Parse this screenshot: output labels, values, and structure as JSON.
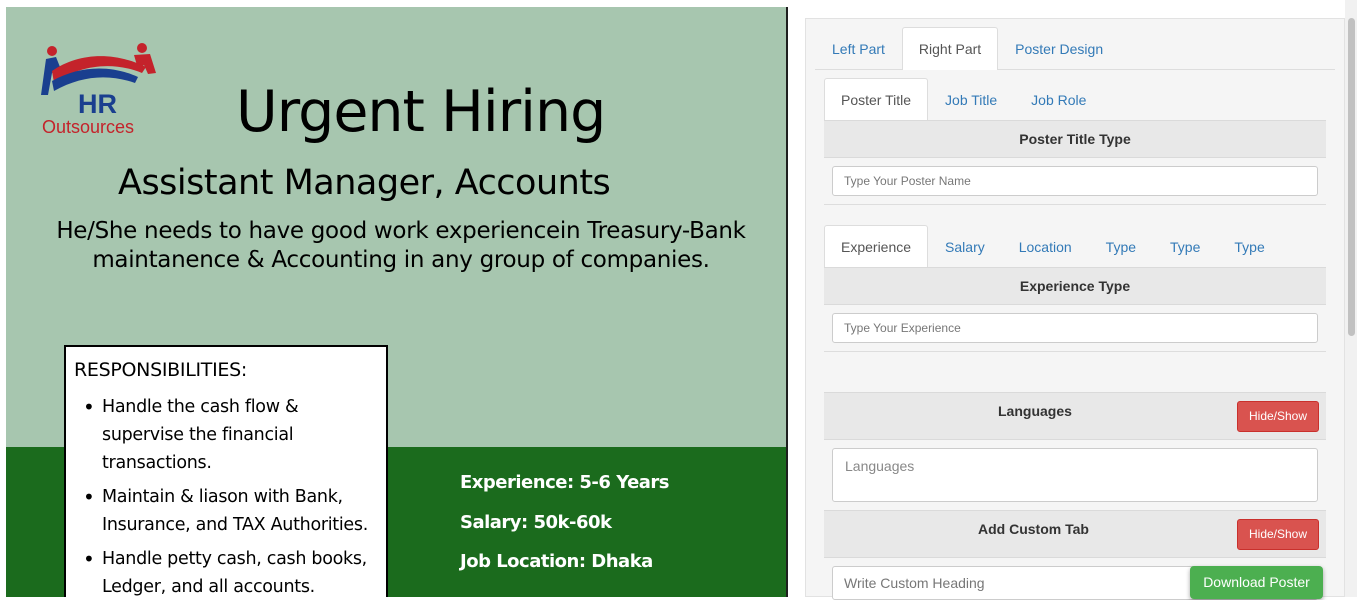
{
  "poster": {
    "logo_main": "HR",
    "logo_sub": "Outsources",
    "title": "Urgent Hiring",
    "subtitle": "Assistant Manager, Accounts",
    "description": "He/She needs to have good work experiencein Treasury-Bank maintanence & Accounting in any group of companies.",
    "responsibilities_title": "RESPONSIBILITIES:",
    "responsibilities": [
      "Handle the cash flow & supervise the financial transactions.",
      "Maintain & liason with Bank, Insurance, and TAX Authorities.",
      "Handle petty cash, cash books, Ledger, and all accounts."
    ],
    "experience": "Experience: 5-6 Years",
    "salary": "Salary: 50k-60k",
    "location": "Job Location: Dhaka",
    "colors": {
      "background": "#a7c6af",
      "band": "#1b6b1d",
      "logo_blue": "#1a3f8f",
      "logo_red": "#c4232b"
    }
  },
  "editor": {
    "main_tabs": [
      "Left Part",
      "Right Part",
      "Poster Design"
    ],
    "sub_tabs_1": [
      "Poster Title",
      "Job Title",
      "Job Role"
    ],
    "poster_title_section": {
      "heading": "Poster Title Type",
      "placeholder": "Type Your Poster Name"
    },
    "sub_tabs_2": [
      "Experience",
      "Salary",
      "Location",
      "Type",
      "Type",
      "Type"
    ],
    "experience_section": {
      "heading": "Experience Type",
      "placeholder": "Type Your Experience"
    },
    "languages_section": {
      "heading": "Languages",
      "toggle_label": "Hide/Show",
      "placeholder": "Languages"
    },
    "custom_tab_section": {
      "heading": "Add Custom Tab",
      "toggle_label": "Hide/Show",
      "placeholder": "Write Custom Heading"
    },
    "download_label": "Download Poster",
    "colors": {
      "link": "#337ab7",
      "danger": "#d9534f",
      "success": "#4caf50"
    }
  }
}
